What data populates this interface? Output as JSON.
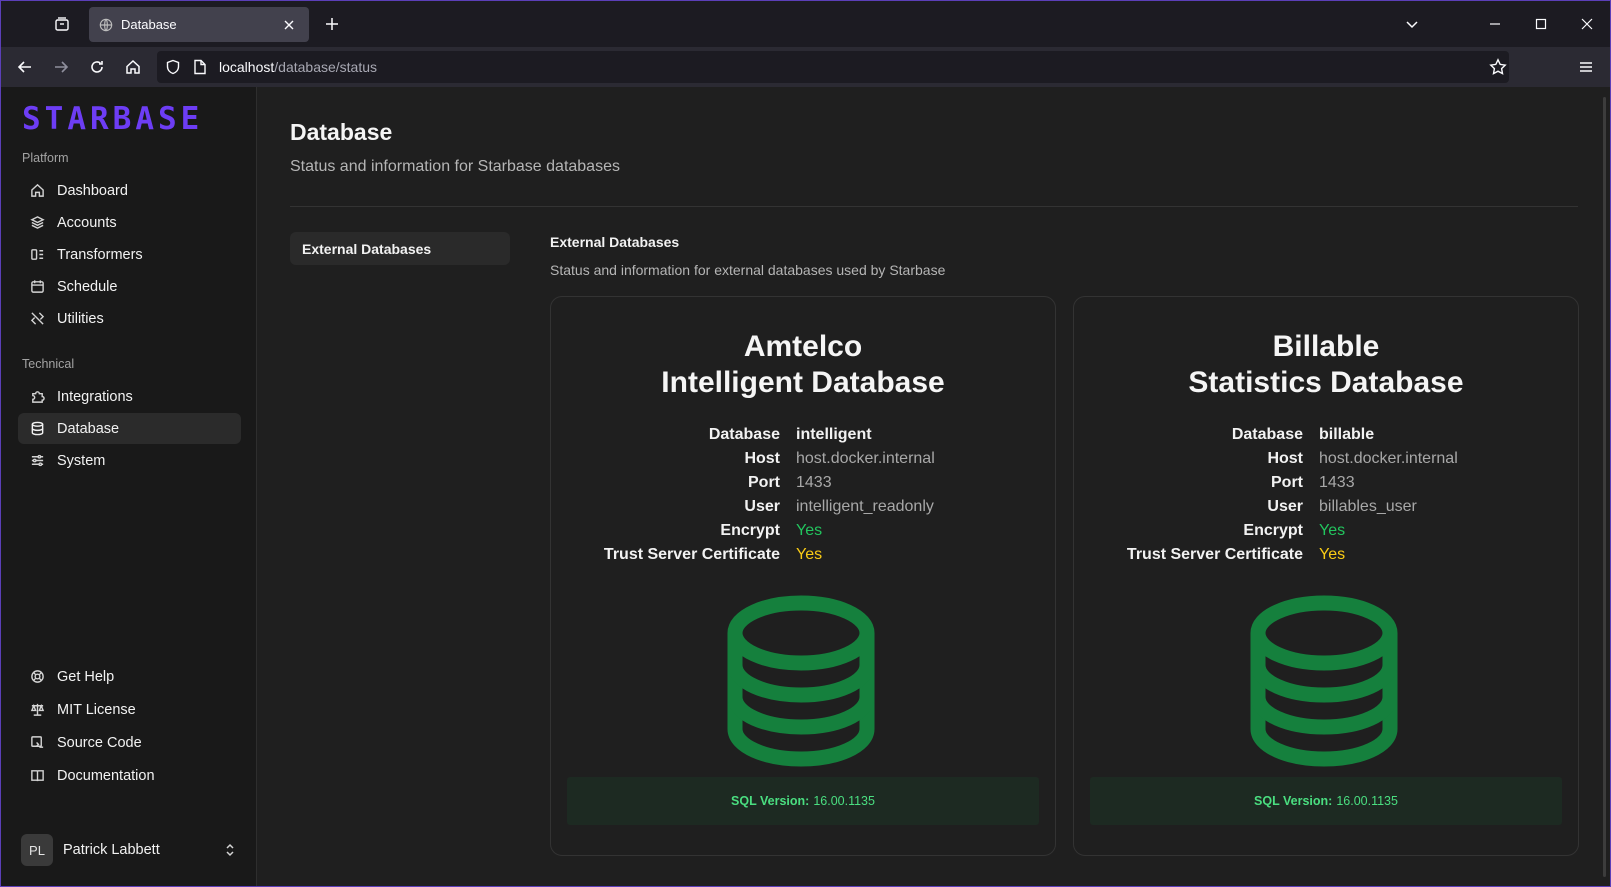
{
  "browser": {
    "tab_title": "Database",
    "url_host": "localhost",
    "url_path": "/database/status"
  },
  "sidebar": {
    "logo": "STARBASE",
    "platform_label": "Platform",
    "technical_label": "Technical",
    "platform_items": [
      {
        "label": "Dashboard",
        "icon": "home-icon"
      },
      {
        "label": "Accounts",
        "icon": "layers-icon"
      },
      {
        "label": "Transformers",
        "icon": "transform-icon"
      },
      {
        "label": "Schedule",
        "icon": "calendar-icon"
      },
      {
        "label": "Utilities",
        "icon": "tools-icon"
      }
    ],
    "technical_items": [
      {
        "label": "Integrations",
        "icon": "puzzle-icon"
      },
      {
        "label": "Database",
        "icon": "database-icon"
      },
      {
        "label": "System",
        "icon": "sliders-icon"
      }
    ],
    "footer_items": [
      {
        "label": "Get Help",
        "icon": "help-icon"
      },
      {
        "label": "MIT License",
        "icon": "scale-icon"
      },
      {
        "label": "Source Code",
        "icon": "code-icon"
      },
      {
        "label": "Documentation",
        "icon": "book-icon"
      }
    ],
    "user": {
      "initials": "PL",
      "name": "Patrick Labbett"
    }
  },
  "main": {
    "title": "Database",
    "subtitle": "Status and information for Starbase databases",
    "subnav": [
      "External Databases"
    ],
    "section_title": "External Databases",
    "section_subtitle": "Status and information for external databases used by Starbase",
    "version_label": "SQL Version:",
    "info_labels": {
      "database": "Database",
      "host": "Host",
      "port": "Port",
      "user": "User",
      "encrypt": "Encrypt",
      "trust": "Trust Server Certificate"
    },
    "cards": [
      {
        "title_line1": "Amtelco",
        "title_line2": "Intelligent Database",
        "database": "intelligent",
        "host": "host.docker.internal",
        "port": "1433",
        "user": "intelligent_readonly",
        "encrypt": "Yes",
        "trust": "Yes",
        "version": "16.00.1135"
      },
      {
        "title_line1": "Billable",
        "title_line2": "Statistics Database",
        "database": "billable",
        "host": "host.docker.internal",
        "port": "1433",
        "user": "billables_user",
        "encrypt": "Yes",
        "trust": "Yes",
        "version": "16.00.1135"
      }
    ]
  },
  "colors": {
    "brand": "#6d3df5",
    "success": "#22c55e",
    "warning": "#facc15",
    "db_icon": "#15803d"
  }
}
